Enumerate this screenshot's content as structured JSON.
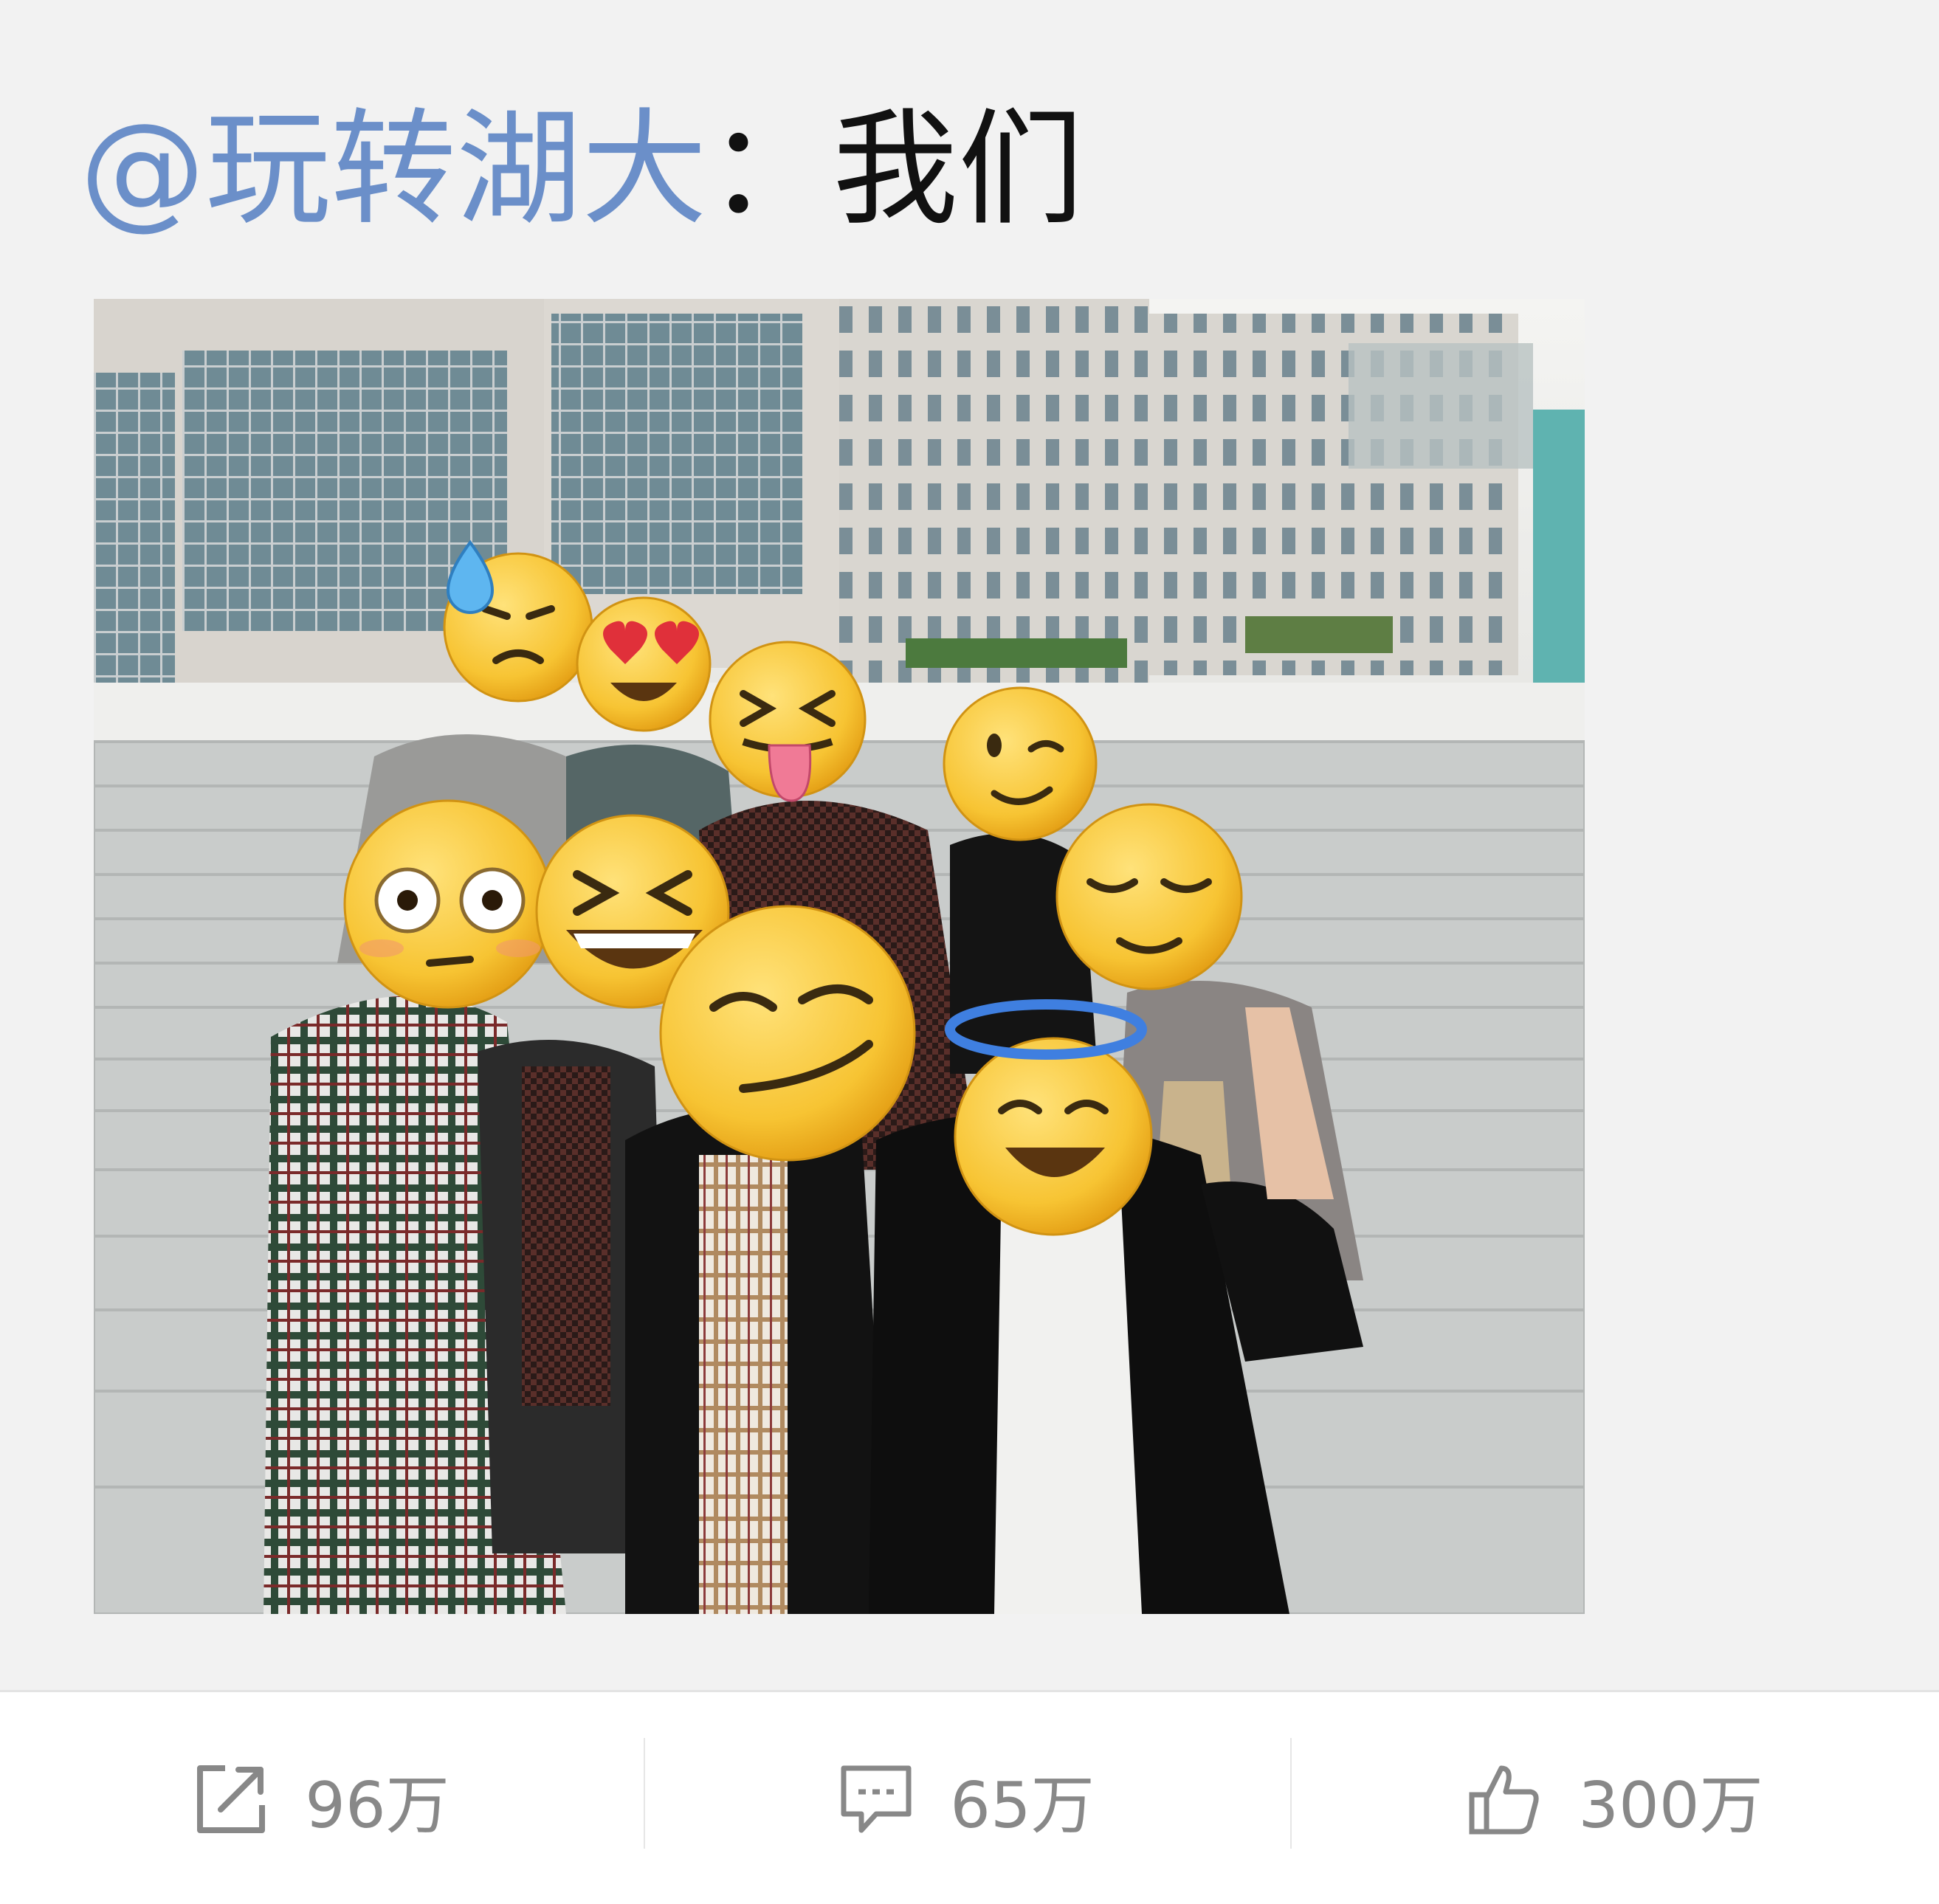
{
  "post": {
    "mention": "@玩转湖大",
    "separator": "：",
    "text": "我们"
  },
  "photo": {
    "faces": [
      "downcast-sweat-emoji",
      "heart-eyes-emoji",
      "squinting-tongue-emoji",
      "winking-emoji",
      "flushed-emoji",
      "laughing-emoji",
      "smirking-emoji",
      "relieved-emoji",
      "halo-emoji"
    ]
  },
  "actions": {
    "repost": {
      "icon": "share-icon",
      "count": "96万"
    },
    "comment": {
      "icon": "comment-icon",
      "count": "65万"
    },
    "like": {
      "icon": "thumbs-up-icon",
      "count": "300万"
    }
  },
  "colors": {
    "mention": "#6b8fc9",
    "text": "#111111",
    "action_text": "#888888",
    "background": "#f2f2f2",
    "action_bar": "#ffffff"
  }
}
